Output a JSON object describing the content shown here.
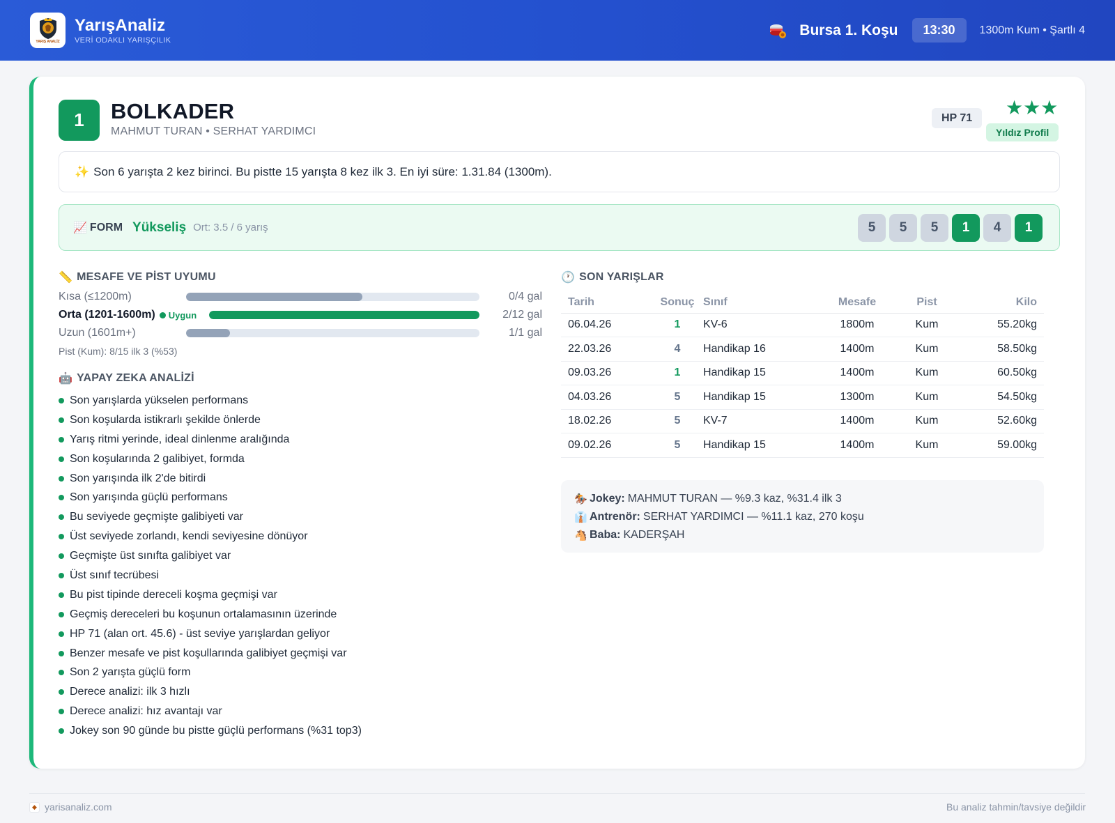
{
  "header": {
    "brand_name": "YarışAnaliz",
    "brand_tagline": "VERİ ODAKLI YARIŞÇILIK",
    "logo_text": "YARIŞ ANALİZ",
    "race_title": "Bursa 1. Koşu",
    "race_time": "13:30",
    "race_info": "1300m Kum • Şartlı 4"
  },
  "horse": {
    "number": "1",
    "name": "BOLKADER",
    "connections": "MAHMUT TURAN • SERHAT YARDIMCI",
    "hp": "HP 71",
    "stars": "★★★",
    "star_label": "Yıldız Profil",
    "summary_icon": "✨",
    "summary": "Son 6 yarışta 2 kez birinci. Bu pistte 15 yarışta 8 kez ilk 3. En iyi süre: 1.31.84 (1300m)."
  },
  "form": {
    "icon": "chart-increasing-icon",
    "label": "FORM",
    "trend": "Yükseliş",
    "average": "Ort: 3.5 / 6 yarış",
    "results": [
      {
        "value": "5",
        "win": false
      },
      {
        "value": "5",
        "win": false
      },
      {
        "value": "5",
        "win": false
      },
      {
        "value": "1",
        "win": true
      },
      {
        "value": "4",
        "win": false
      },
      {
        "value": "1",
        "win": true
      }
    ]
  },
  "distance": {
    "title": "MESAFE VE PİST UYUMU",
    "rows": [
      {
        "label": "Kısa (≤1200m)",
        "value": "0/4 gal",
        "fill": 0.6,
        "active": false
      },
      {
        "label": "Orta (1201-1600m)",
        "value": "2/12 gal",
        "fill": 1.0,
        "active": true,
        "badge": "Uygun"
      },
      {
        "label": "Uzun (1601m+)",
        "value": "1/1 gal",
        "fill": 0.15,
        "active": false
      }
    ],
    "pist": "Pist (Kum): 8/15 ilk 3 (%53)"
  },
  "ai": {
    "title": "YAPAY ZEKA ANALİZİ",
    "items": [
      "Son yarışlarda yükselen performans",
      "Son koşularda istikrarlı şekilde önlerde",
      "Yarış ritmi yerinde, ideal dinlenme aralığında",
      "Son koşularında 2 galibiyet, formda",
      "Son yarışında ilk 2'de bitirdi",
      "Son yarışında güçlü performans",
      "Bu seviyede geçmişte galibiyeti var",
      "Üst seviyede zorlandı, kendi seviyesine dönüyor",
      "Geçmişte üst sınıfta galibiyet var",
      "Üst sınıf tecrübesi",
      "Bu pist tipinde dereceli koşma geçmişi var",
      "Geçmiş dereceleri bu koşunun ortalamasının üzerinde",
      "HP 71 (alan ort. 45.6) - üst seviye yarışlardan geliyor",
      "Benzer mesafe ve pist koşullarında galibiyet geçmişi var",
      "Son 2 yarışta güçlü form",
      "Derece analizi: ilk 3 hızlı",
      "Derece analizi: hız avantajı var",
      "Jokey son 90 günde bu pistte güçlü performans (%31 top3)"
    ]
  },
  "recent": {
    "title": "SON YARIŞLAR",
    "columns": [
      "Tarih",
      "Sonuç",
      "Sınıf",
      "Mesafe",
      "Pist",
      "Kilo"
    ],
    "rows": [
      {
        "date": "06.04.26",
        "result": "1",
        "class": "KV-6",
        "distance": "1800m",
        "track": "Kum",
        "weight": "55.20kg"
      },
      {
        "date": "22.03.26",
        "result": "4",
        "class": "Handikap 16",
        "distance": "1400m",
        "track": "Kum",
        "weight": "58.50kg"
      },
      {
        "date": "09.03.26",
        "result": "1",
        "class": "Handikap 15",
        "distance": "1400m",
        "track": "Kum",
        "weight": "60.50kg"
      },
      {
        "date": "04.03.26",
        "result": "5",
        "class": "Handikap 15",
        "distance": "1300m",
        "track": "Kum",
        "weight": "54.50kg"
      },
      {
        "date": "18.02.26",
        "result": "5",
        "class": "KV-7",
        "distance": "1400m",
        "track": "Kum",
        "weight": "52.60kg"
      },
      {
        "date": "09.02.26",
        "result": "5",
        "class": "Handikap 15",
        "distance": "1400m",
        "track": "Kum",
        "weight": "59.00kg"
      }
    ]
  },
  "people": {
    "jockey_label": "Jokey:",
    "jockey": "MAHMUT TURAN — %9.3 kaz, %31.4 ilk 3",
    "trainer_label": "Antrenör:",
    "trainer": "SERHAT YARDIMCI — %11.1 kaz, 270 koşu",
    "sire_label": "Baba:",
    "sire": "KADERŞAH"
  },
  "footer": {
    "site": "yarisanaliz.com",
    "disclaimer": "Bu analiz tahmin/tavsiye değildir"
  },
  "colors": {
    "header": "#2451cf",
    "accent_green": "#12995d",
    "form_bg": "#ebfaf2",
    "neutral_chip": "#cfd6e0"
  }
}
